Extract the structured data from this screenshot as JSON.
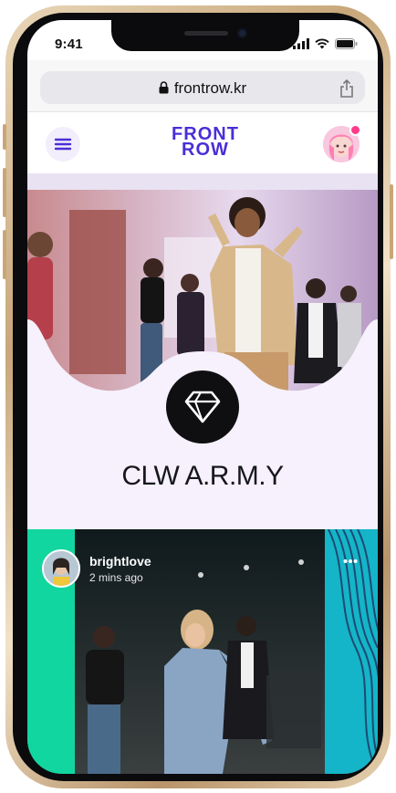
{
  "status_bar": {
    "time": "9:41"
  },
  "browser": {
    "url": "frontrow.kr"
  },
  "app": {
    "logo_line1": "FRONT",
    "logo_line2": "ROW"
  },
  "community": {
    "name": "CLW A.R.M.Y"
  },
  "post": {
    "username": "brightlove",
    "timestamp": "2 mins ago"
  },
  "colors": {
    "brand": "#4b2ed6",
    "hero_bg": "#f6f1fc",
    "feed_left": "#12d6a0",
    "feed_right": "#14b5c8"
  },
  "icons": [
    "menu-icon",
    "lock-icon",
    "share-icon",
    "diamond-heart-icon",
    "more-icon",
    "signal-icon",
    "wifi-icon",
    "battery-icon"
  ]
}
